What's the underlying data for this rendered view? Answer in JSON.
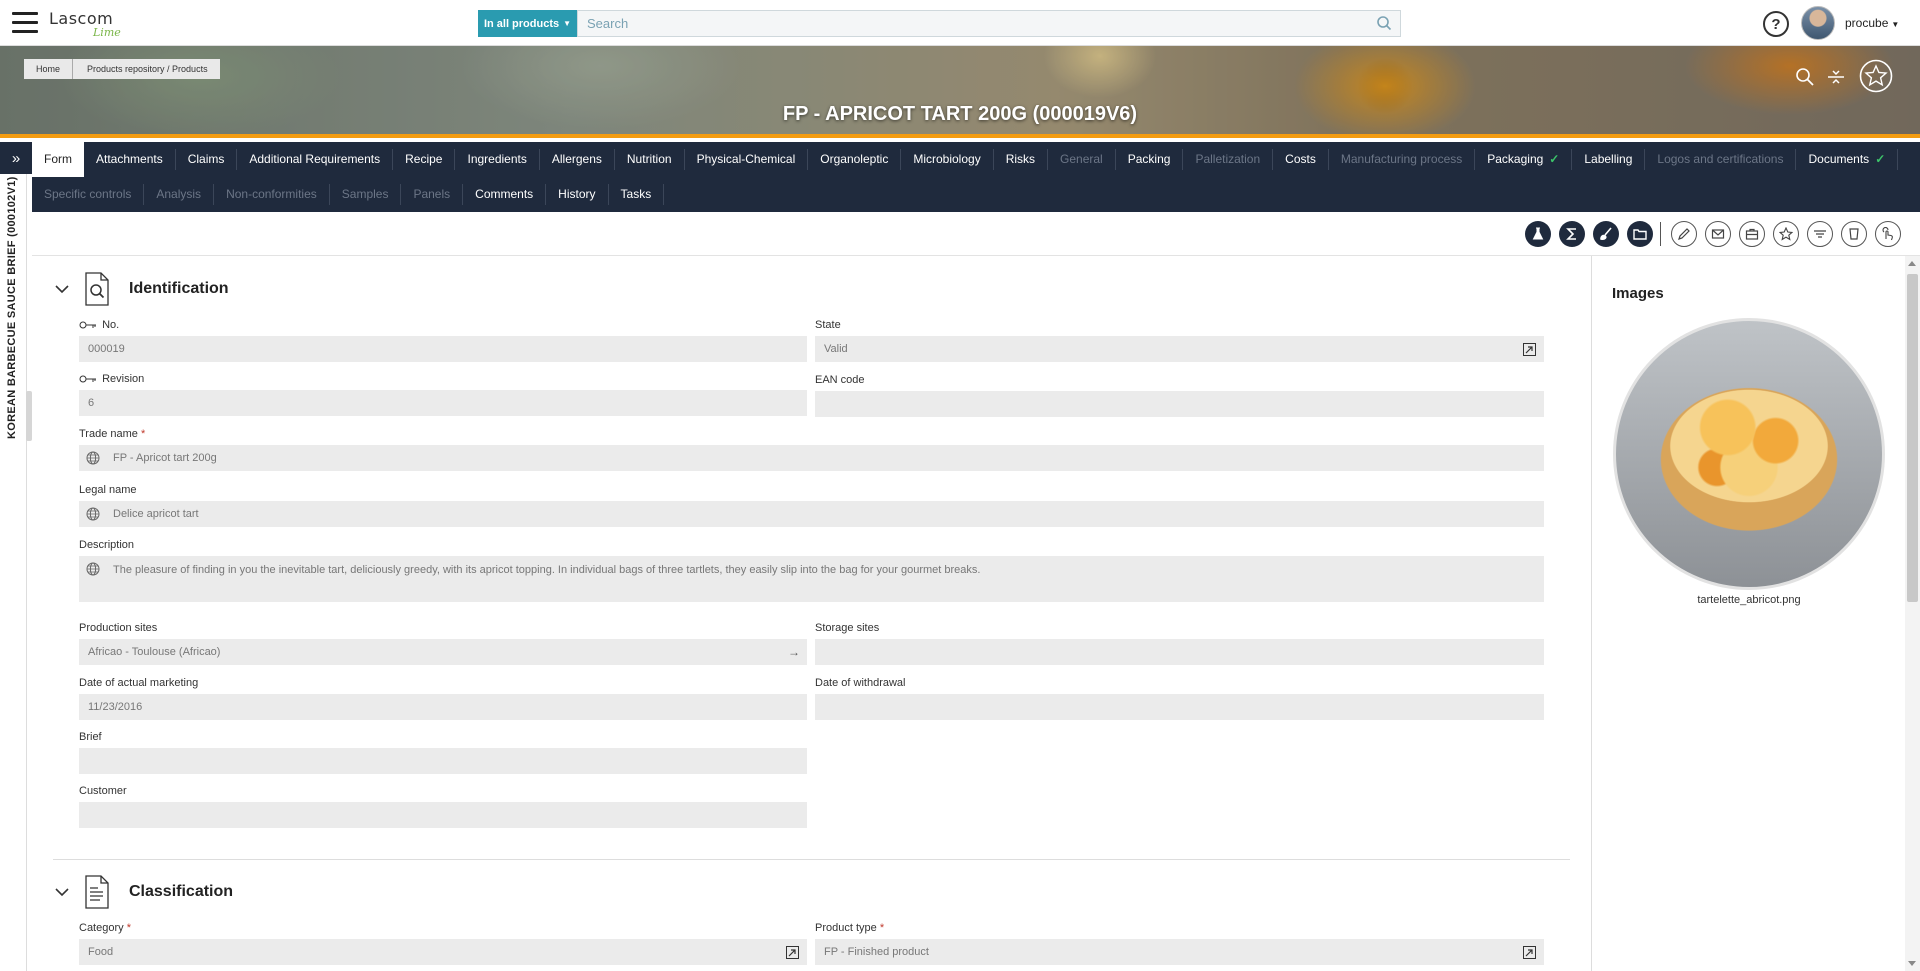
{
  "topbar": {
    "logo_main": "Lascom",
    "logo_sub": "Lime",
    "search_scope": "In all products",
    "search_placeholder": "Search",
    "help": "?",
    "user": "procube"
  },
  "banner": {
    "breadcrumb": [
      "Home",
      "Products repository / Products"
    ],
    "title": "FP - APRICOT TART 200G (000019V6)"
  },
  "sidepanel": {
    "expand": "»",
    "vertical_title": "KOREAN BARBECUE SAUCE BRIEF (000102V1)"
  },
  "tabs": {
    "row1": [
      {
        "label": "Form",
        "state": "active"
      },
      {
        "label": "Attachments",
        "state": "normal"
      },
      {
        "label": "Claims",
        "state": "normal"
      },
      {
        "label": "Additional Requirements",
        "state": "normal"
      },
      {
        "label": "Recipe",
        "state": "normal"
      },
      {
        "label": "Ingredients",
        "state": "normal"
      },
      {
        "label": "Allergens",
        "state": "normal"
      },
      {
        "label": "Nutrition",
        "state": "normal"
      },
      {
        "label": "Physical-Chemical",
        "state": "normal"
      },
      {
        "label": "Organoleptic",
        "state": "normal"
      },
      {
        "label": "Microbiology",
        "state": "normal"
      },
      {
        "label": "Risks",
        "state": "normal"
      },
      {
        "label": "General",
        "state": "dim"
      },
      {
        "label": "Packing",
        "state": "normal"
      },
      {
        "label": "Palletization",
        "state": "dim"
      },
      {
        "label": "Costs",
        "state": "normal"
      },
      {
        "label": "Manufacturing process",
        "state": "dim"
      },
      {
        "label": "Packaging",
        "state": "normal",
        "check": "✓"
      },
      {
        "label": "Labelling",
        "state": "normal"
      },
      {
        "label": "Logos and certifications",
        "state": "dim"
      },
      {
        "label": "Documents",
        "state": "normal",
        "check": "✓"
      }
    ],
    "row2": [
      {
        "label": "Specific controls",
        "state": "dim"
      },
      {
        "label": "Analysis",
        "state": "dim"
      },
      {
        "label": "Non-conformities",
        "state": "dim"
      },
      {
        "label": "Samples",
        "state": "dim"
      },
      {
        "label": "Panels",
        "state": "dim"
      },
      {
        "label": "Comments",
        "state": "normal"
      },
      {
        "label": "History",
        "state": "normal"
      },
      {
        "label": "Tasks",
        "state": "normal"
      }
    ]
  },
  "toolbar": {
    "icons": [
      "flask-icon",
      "sigma-icon",
      "brush-icon",
      "folder-icon",
      "pencil-icon",
      "envelope-icon",
      "briefcase-icon",
      "star-icon",
      "filter-lines-icon",
      "cup-icon",
      "hand-touch-icon"
    ]
  },
  "identification": {
    "title": "Identification",
    "no_label": "No.",
    "no_value": "000019",
    "state_label": "State",
    "state_value": "Valid",
    "revision_label": "Revision",
    "revision_value": "6",
    "ean_label": "EAN code",
    "ean_value": "",
    "trade_name_label": "Trade name",
    "trade_name_value": "FP - Apricot tart 200g",
    "legal_name_label": "Legal name",
    "legal_name_value": "Delice apricot tart",
    "description_label": "Description",
    "description_value": "The pleasure of finding in you the inevitable tart, deliciously greedy, with its apricot topping. In individual bags of three tartlets, they easily slip into the bag for your gourmet breaks.",
    "production_sites_label": "Production sites",
    "production_sites_value": "Africao - Toulouse (Africao)",
    "storage_sites_label": "Storage sites",
    "storage_sites_value": "",
    "date_marketing_label": "Date of actual marketing",
    "date_marketing_value": "11/23/2016",
    "date_withdrawal_label": "Date of withdrawal",
    "date_withdrawal_value": "",
    "brief_label": "Brief",
    "brief_value": "",
    "customer_label": "Customer",
    "customer_value": "",
    "required_mark": "*"
  },
  "classification": {
    "title": "Classification",
    "category_label": "Category",
    "category_value": "Food",
    "product_type_label": "Product type",
    "product_type_value": "FP - Finished product"
  },
  "images": {
    "title": "Images",
    "caption": "tartelette_abricot.png"
  },
  "colors": {
    "nav_dark": "#1f2a3d",
    "accent_teal": "#2a9bb0",
    "banner_underline": "#f39c12",
    "check_green": "#3cc46a"
  }
}
